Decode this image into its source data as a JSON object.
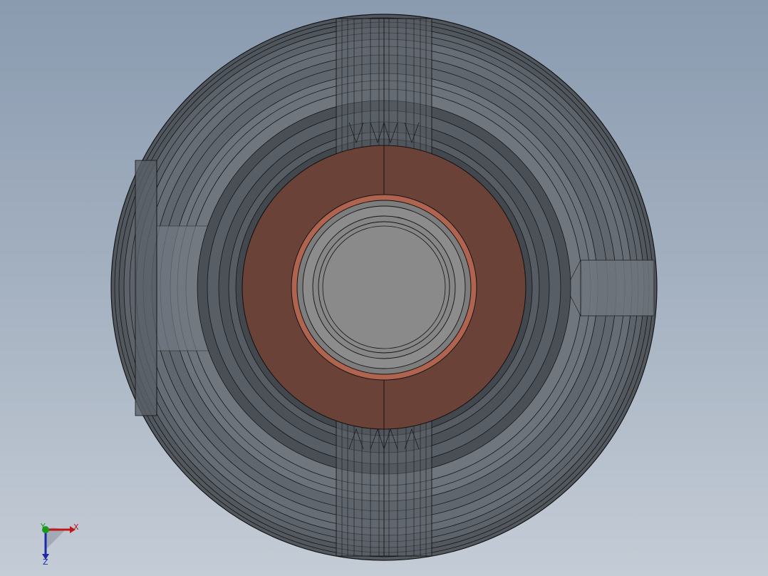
{
  "viewport": {
    "background_top": "#8a9bb0",
    "background_bottom": "#c4ccd6"
  },
  "model": {
    "body_color": "#565b62",
    "translucent_gray": "#6b7078",
    "bearing_color": "#6b4238",
    "bushing_ring_color": "#b0644f",
    "shaft_color": "#8a8a8a",
    "edge_color": "#141414"
  },
  "triad": {
    "x_label": "X",
    "y_label": "Y",
    "z_label": "Z",
    "x_color": "#c01818",
    "y_color": "#1a9a1a",
    "z_color": "#1a2aa8"
  }
}
